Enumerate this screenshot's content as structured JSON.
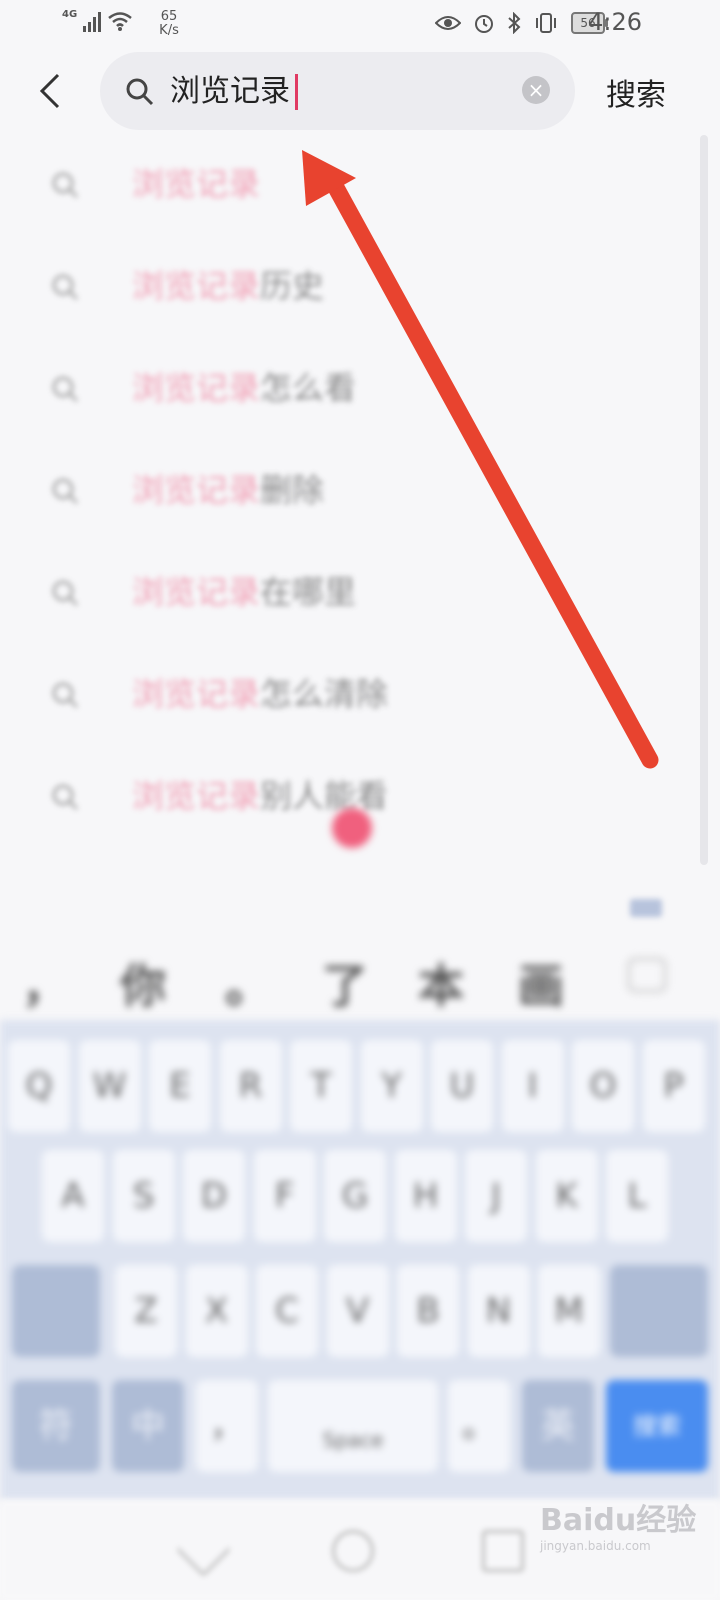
{
  "status_bar": {
    "network_type": "4G",
    "speed_value": "65",
    "speed_unit": "K/s",
    "battery": "56",
    "time": "4:26",
    "icons": [
      "eye-icon",
      "alarm-icon",
      "bluetooth-icon",
      "vibrate-icon"
    ]
  },
  "search": {
    "query": "浏览记录",
    "search_button": "搜索"
  },
  "suggestions": [
    {
      "highlight": "浏览记录",
      "rest": ""
    },
    {
      "highlight": "浏览记录",
      "rest": "历史"
    },
    {
      "highlight": "浏览记录",
      "rest": "怎么看"
    },
    {
      "highlight": "浏览记录",
      "rest": "删除"
    },
    {
      "highlight": "浏览记录",
      "rest": "在哪里"
    },
    {
      "highlight": "浏览记录",
      "rest": "怎么清除"
    },
    {
      "highlight": "浏览记录",
      "rest": "别人能看"
    }
  ],
  "candidates": [
    "，",
    "你",
    "。",
    "了",
    "本",
    "画"
  ],
  "keyboard": {
    "row1": [
      "Q",
      "W",
      "E",
      "R",
      "T",
      "Y",
      "U",
      "I",
      "O",
      "P"
    ],
    "row2": [
      "A",
      "S",
      "D",
      "F",
      "G",
      "H",
      "J",
      "K",
      "L"
    ],
    "row3": [
      "Z",
      "X",
      "C",
      "V",
      "B",
      "N",
      "M"
    ],
    "row4": [
      "符",
      "中",
      "，",
      "Space",
      "。",
      "英",
      "搜索"
    ]
  },
  "watermark": {
    "main": "Baidu经验",
    "sub": "jingyan.baidu.com"
  },
  "colors": {
    "accent": "#e03a63",
    "arrow": "#e8432f",
    "enter_key": "#4a8df0"
  }
}
